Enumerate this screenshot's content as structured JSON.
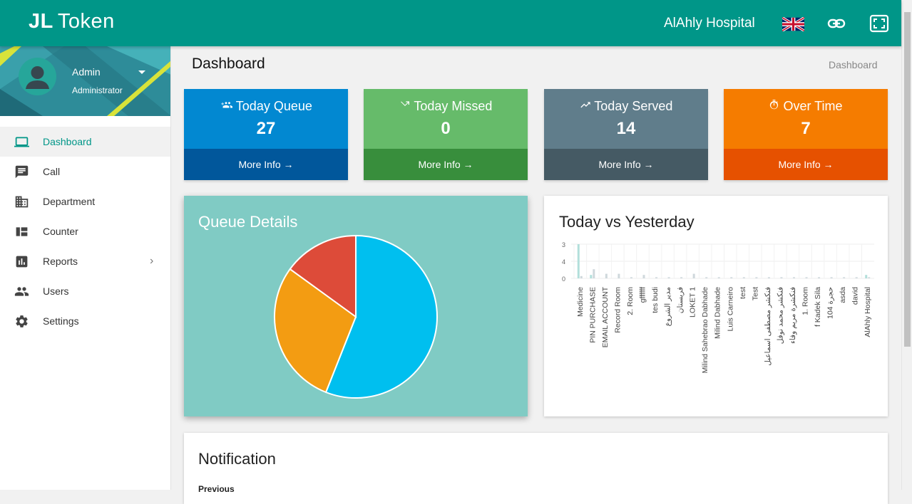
{
  "topbar": {
    "brand_bold": "JL",
    "brand_rest": "Token",
    "hospital": "AlAhly Hospital"
  },
  "user": {
    "name": "Admin",
    "role": "Administrator"
  },
  "menu": [
    {
      "label": "Dashboard",
      "icon": "laptop-icon",
      "active": true
    },
    {
      "label": "Call",
      "icon": "chat-icon"
    },
    {
      "label": "Department",
      "icon": "building-icon"
    },
    {
      "label": "Counter",
      "icon": "dashboard-grid-icon"
    },
    {
      "label": "Reports",
      "icon": "bar-chart-icon",
      "has_submenu": true
    },
    {
      "label": "Users",
      "icon": "people-icon"
    },
    {
      "label": "Settings",
      "icon": "gear-icon"
    }
  ],
  "page": {
    "title": "Dashboard",
    "breadcrumb": "Dashboard"
  },
  "stats": [
    {
      "title": "Today Queue",
      "value": "27",
      "icon": "group-add-icon",
      "link": "More Info",
      "color": "#0288d1",
      "footer_color": "#01579b"
    },
    {
      "title": "Today Missed",
      "value": "0",
      "icon": "missed-icon",
      "link": "More Info",
      "color": "#66bb6a",
      "footer_color": "#388e3c"
    },
    {
      "title": "Today Served",
      "value": "14",
      "icon": "trending-up-icon",
      "link": "More Info",
      "color": "#607d8b",
      "footer_color": "#455a64"
    },
    {
      "title": "Over Time",
      "value": "7",
      "icon": "timer-icon",
      "link": "More Info",
      "color": "#f57c00",
      "footer_color": "#e65100"
    }
  ],
  "panels": {
    "queue_details": "Queue Details",
    "today_vs_yesterday": "Today vs Yesterday",
    "notification": "Notification",
    "notification_sub": "Previous"
  },
  "chart_data": [
    {
      "type": "pie",
      "values": [
        56,
        29,
        15
      ],
      "colors": [
        "#00bfef",
        "#f39c12",
        "#dd4b39"
      ]
    },
    {
      "type": "bar",
      "yticks": [
        "3",
        "4",
        "0"
      ],
      "categories": [
        "Medicine",
        "PIN PURCHASE",
        "EMAIL ACCOUNT",
        "Record Room",
        "2. Room",
        "gffffff",
        "tes budi",
        "مدير الشروع",
        "فريستان",
        "LOKET 1",
        "Milind Sahebrao Dabhade",
        "Milind Dabhade",
        "Luis Carneiro",
        "test",
        "Test",
        "فنكشر مصطفى اسماعيل",
        "فنكشر محمد نوفل",
        "فنكشرة مريم وفاء",
        "1. Room",
        "f Kadek Sila",
        "104 حجرة",
        "asda",
        "david",
        "AlAhly Hospital"
      ],
      "series": [
        {
          "values": [
            3,
            0.3,
            0,
            0,
            0,
            0,
            0,
            0,
            0,
            0,
            0,
            0,
            0,
            0,
            0,
            0,
            0,
            0,
            0,
            0,
            0,
            0,
            0,
            0.3
          ],
          "color": "#b2dfdb"
        },
        {
          "values": [
            0.2,
            0.8,
            0.4,
            0.4,
            0.1,
            0.3,
            0.1,
            0.1,
            0.1,
            0.4,
            0.1,
            0.1,
            0.1,
            0.1,
            0.1,
            0.1,
            0.1,
            0.1,
            0.1,
            0.1,
            0.1,
            0.1,
            0.1,
            0.1
          ],
          "color": "#cfd8dc"
        }
      ]
    }
  ]
}
